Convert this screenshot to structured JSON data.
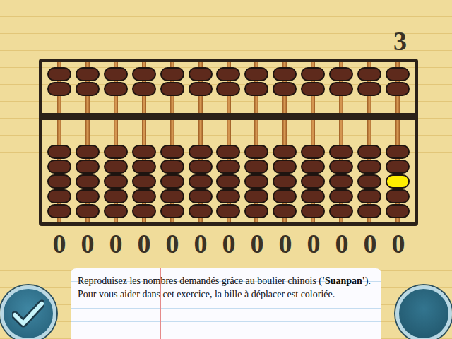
{
  "target": "3",
  "abacus": {
    "upper_beads": 2,
    "lower_beads": 5,
    "rods": [
      {
        "digit": "0",
        "highlight": null
      },
      {
        "digit": "0",
        "highlight": null
      },
      {
        "digit": "0",
        "highlight": null
      },
      {
        "digit": "0",
        "highlight": null
      },
      {
        "digit": "0",
        "highlight": null
      },
      {
        "digit": "0",
        "highlight": null
      },
      {
        "digit": "0",
        "highlight": null
      },
      {
        "digit": "0",
        "highlight": null
      },
      {
        "digit": "0",
        "highlight": null
      },
      {
        "digit": "0",
        "highlight": null
      },
      {
        "digit": "0",
        "highlight": null
      },
      {
        "digit": "0",
        "highlight": null
      },
      {
        "digit": "0",
        "highlight": {
          "section": "lower",
          "index": 2
        }
      }
    ]
  },
  "instructions": [
    [
      {
        "text": "Reproduisez les nombres demandés grâce au boulier chinois (",
        "bold": false
      },
      {
        "text": "'Suanpan'",
        "bold": true
      },
      {
        "text": ").",
        "bold": false
      }
    ],
    [
      {
        "text": "Pour vous aider dans cet exercice, la bille à déplacer est coloriée.",
        "bold": false
      }
    ]
  ],
  "buttons": [
    {
      "kind": "check"
    },
    {
      "kind": "blank"
    }
  ]
}
